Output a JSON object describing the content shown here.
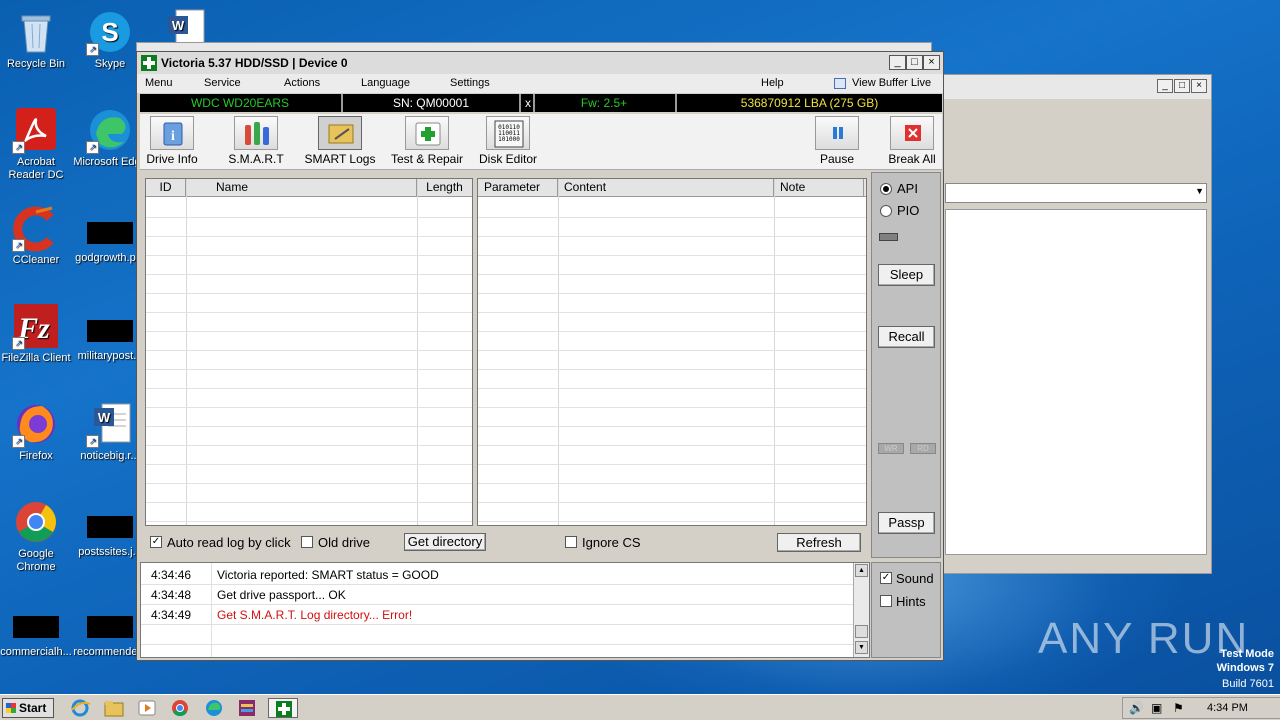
{
  "desktop": {
    "icons": [
      {
        "label": "Recycle Bin"
      },
      {
        "label": "Skype"
      },
      {
        "label": "Acrobat Reader DC"
      },
      {
        "label": "Microsoft Edge"
      },
      {
        "label": "CCleaner"
      },
      {
        "label": "godgrowth.p..."
      },
      {
        "label": "FileZilla Client"
      },
      {
        "label": "militarypost..."
      },
      {
        "label": "Firefox"
      },
      {
        "label": "noticebig.r..."
      },
      {
        "label": "Google Chrome"
      },
      {
        "label": "postssites.j..."
      },
      {
        "label": "commercialh..."
      },
      {
        "label": "recommende..."
      }
    ],
    "watermark": "ANY RUN",
    "test_mode": {
      "line1": "Test Mode",
      "line2": "Windows 7",
      "line3": "Build 7601"
    }
  },
  "window": {
    "title": "Victoria 5.37 HDD/SSD | Device 0",
    "menu": [
      "Menu",
      "Service",
      "Actions",
      "Language",
      "Settings",
      "Help",
      "View Buffer Live"
    ],
    "drive": {
      "model": "WDC WD20EARS",
      "serial": "SN: QM00001",
      "close": "x",
      "firmware": "Fw: 2.5+",
      "capacity": "536870912 LBA (275 GB)"
    },
    "toolbar": [
      "Drive Info",
      "S.M.A.R.T",
      "SMART Logs",
      "Test & Repair",
      "Disk Editor",
      "Pause",
      "Break All"
    ],
    "left_table": {
      "headers": [
        "ID",
        "Name",
        "Length"
      ]
    },
    "right_table": {
      "headers": [
        "Parameter",
        "Content",
        "Note"
      ]
    },
    "side": {
      "api": "API",
      "pio": "PIO",
      "sleep": "Sleep",
      "recall": "Recall",
      "wr": "WR",
      "rd": "RD",
      "passp": "Passp"
    },
    "options": {
      "auto_read": "Auto read log by click",
      "old_drive": "Old drive",
      "get_directory": "Get directory",
      "ignore_cs": "Ignore CS",
      "refresh": "Refresh"
    },
    "log": [
      {
        "time": "4:34:46",
        "text": "Victoria reported: SMART status = GOOD",
        "color": "#000000"
      },
      {
        "time": "4:34:48",
        "text": "Get drive passport... OK",
        "color": "#000000"
      },
      {
        "time": "4:34:49",
        "text": "Get S.M.A.R.T. Log directory... Error!",
        "color": "#d01010"
      }
    ],
    "sound": "Sound",
    "hints": "Hints"
  },
  "taskbar": {
    "start": "Start",
    "clock": "4:34 PM"
  }
}
